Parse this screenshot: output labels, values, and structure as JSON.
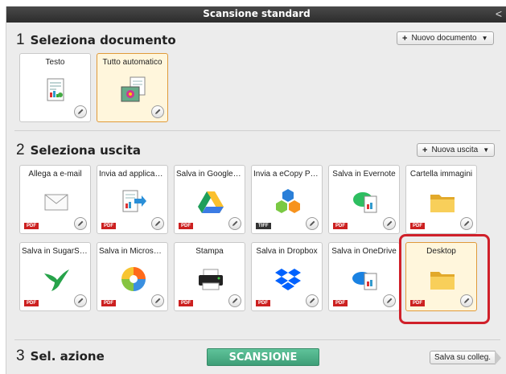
{
  "window": {
    "title": "Scansione standard",
    "back_glyph": "<"
  },
  "step1": {
    "number": "1",
    "label": "Seleziona documento",
    "new_button": "Nuovo documento",
    "tiles": [
      {
        "label": "Testo",
        "selected": false,
        "icon": "text-document-icon"
      },
      {
        "label": "Tutto automatico",
        "selected": true,
        "icon": "auto-photo-document-icon"
      }
    ]
  },
  "step2": {
    "number": "2",
    "label": "Seleziona uscita",
    "new_button": "Nuova uscita",
    "tiles": [
      {
        "label": "Allega a e-mail",
        "badge": "PDF",
        "icon": "envelope-icon"
      },
      {
        "label": "Invia ad applicazio...",
        "badge": "PDF",
        "icon": "send-to-app-icon"
      },
      {
        "label": "Salva in Google Dri...",
        "badge": "PDF",
        "icon": "google-drive-icon"
      },
      {
        "label": "Invia a eCopy PDF ...",
        "badge": "TIFF",
        "icon": "ecopy-icon"
      },
      {
        "label": "Salva in Evernote",
        "badge": "PDF",
        "icon": "evernote-icon"
      },
      {
        "label": "Cartella immagini",
        "badge": "PDF",
        "icon": "folder-icon"
      },
      {
        "label": "Salva in SugarSync",
        "badge": "PDF",
        "icon": "hummingbird-icon"
      },
      {
        "label": "Salva in Microsoft ...",
        "badge": "PDF",
        "icon": "microsoft-ball-icon"
      },
      {
        "label": "Stampa",
        "badge": "PDF",
        "icon": "printer-icon"
      },
      {
        "label": "Salva in Dropbox",
        "badge": "PDF",
        "icon": "dropbox-icon"
      },
      {
        "label": "Salva in OneDrive",
        "badge": "PDF",
        "icon": "onedrive-icon"
      },
      {
        "label": "Desktop",
        "badge": "PDF",
        "icon": "folder-icon",
        "selected": true
      }
    ]
  },
  "step3": {
    "number": "3",
    "label": "Sel. azione",
    "scan_button": "SCANSIONE",
    "save_button": "Salva su colleg."
  },
  "colors": {
    "selection_bg": "#fff6dc",
    "selection_border": "#e09a3a",
    "highlight": "#d0202a",
    "scan_green": "#4caf84"
  }
}
